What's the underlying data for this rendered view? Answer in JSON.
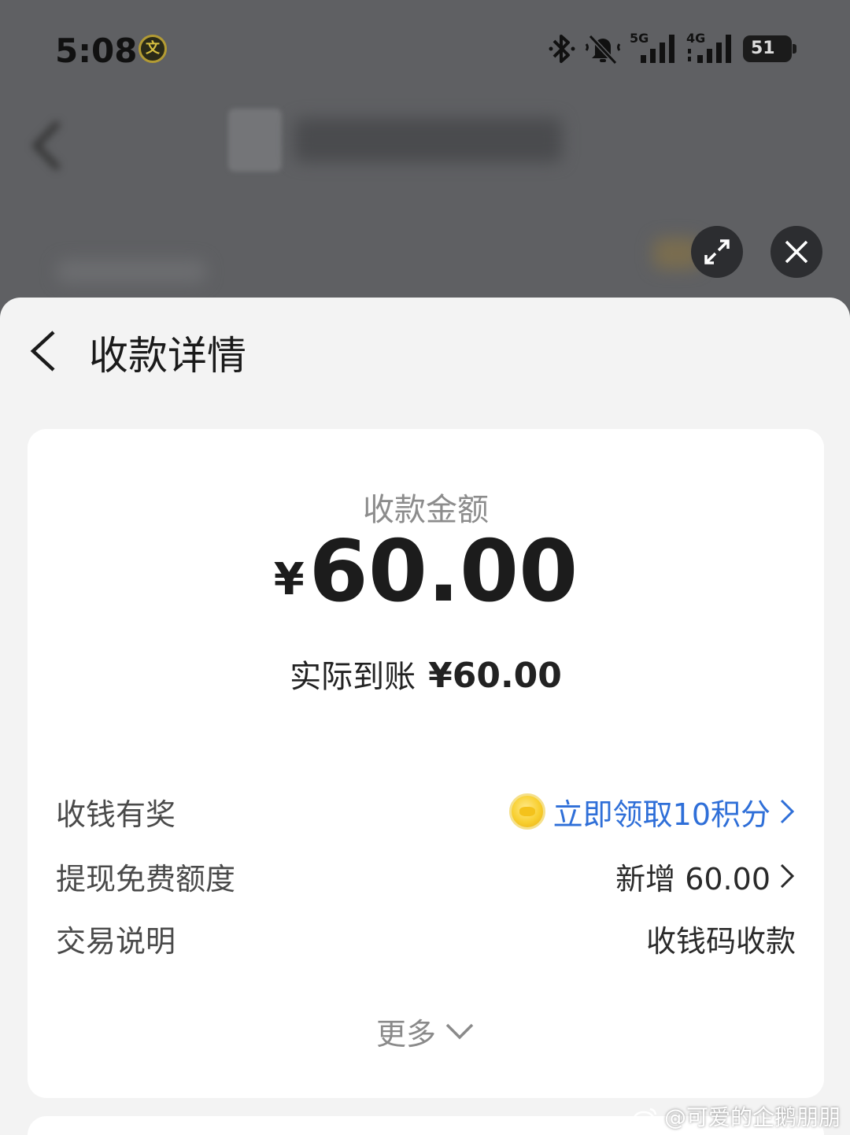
{
  "status_bar": {
    "time": "5:08",
    "app_badge": "文",
    "network_5g": "5G",
    "network_4g": "4G",
    "battery": "51"
  },
  "sheet": {
    "title": "收款详情"
  },
  "summary": {
    "amount_label": "收款金额",
    "currency": "¥",
    "amount": "60.00",
    "actual_label": "实际到账",
    "actual_value": "¥60.00"
  },
  "rows": [
    {
      "label": "收钱有奖",
      "value": "立即领取10积分"
    },
    {
      "label": "提现免费额度",
      "value": "新增 60.00"
    },
    {
      "label": "交易说明",
      "value": "收钱码收款"
    }
  ],
  "more_label": "更多",
  "watermark": "@可爱的企鹅朋朋",
  "colors": {
    "link": "#2f6fd8",
    "coin": "#f8cf2f"
  }
}
